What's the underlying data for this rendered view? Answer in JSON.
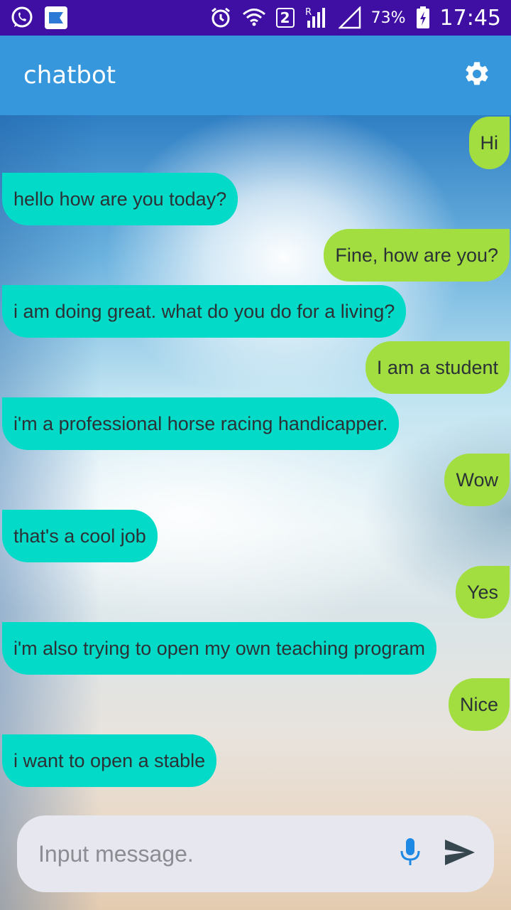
{
  "status_bar": {
    "left_icons": [
      "whatsapp-icon",
      "app-notification-icon"
    ],
    "sim_slot": "2",
    "battery_percent": "73%",
    "time": "17:45"
  },
  "app_bar": {
    "title": "chatbot",
    "settings_icon": "gear-icon"
  },
  "messages": [
    {
      "sender": "user",
      "text": "Hi"
    },
    {
      "sender": "bot",
      "text": "hello how are you today?"
    },
    {
      "sender": "user",
      "text": "Fine, how are you?"
    },
    {
      "sender": "bot",
      "text": "i am doing great. what do you do for a living?"
    },
    {
      "sender": "user",
      "text": "I am a student"
    },
    {
      "sender": "bot",
      "text": "i'm a professional horse racing handicapper."
    },
    {
      "sender": "user",
      "text": "Wow"
    },
    {
      "sender": "bot",
      "text": "that's a cool job"
    },
    {
      "sender": "user",
      "text": "Yes"
    },
    {
      "sender": "bot",
      "text": "i'm also trying to open my own teaching program"
    },
    {
      "sender": "user",
      "text": "Nice"
    },
    {
      "sender": "bot",
      "text": "i want to open a stable"
    }
  ],
  "input": {
    "value": "",
    "placeholder": "Input message.",
    "mic_icon": "microphone-icon",
    "send_icon": "send-icon"
  },
  "colors": {
    "status_bar": "#3f0fa3",
    "app_bar": "#3797dd",
    "bot_bubble": "#03dbc8",
    "user_bubble": "#a2de40",
    "mic_accent": "#1e88e5",
    "send_icon": "#37474f"
  }
}
